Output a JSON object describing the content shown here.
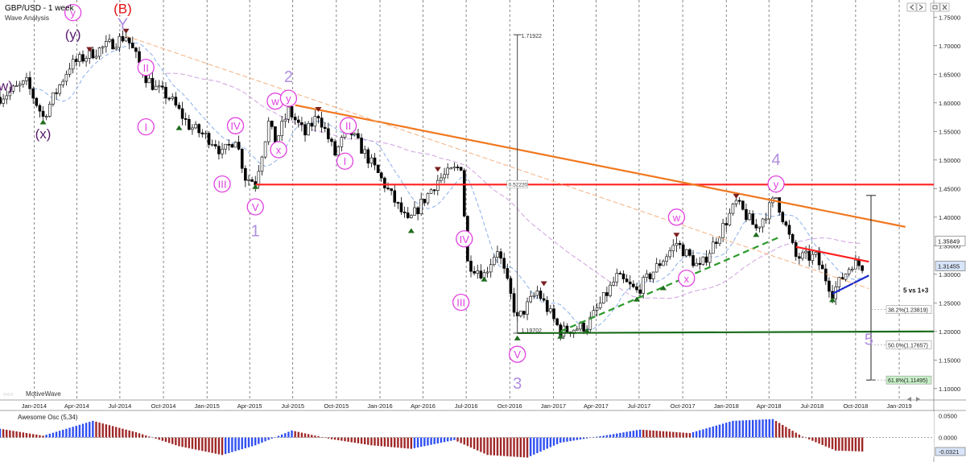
{
  "header": {
    "title": "GBP/USD - 1 week",
    "subtitle": "Wave Analysis",
    "watermark": "MotiveWave"
  },
  "toolbar_icons": [
    "back-icon",
    "forward-icon",
    "restore-icon",
    "close-icon"
  ],
  "colors": {
    "candle_up": "#ffffff",
    "candle_down": "#000000",
    "wave_pink": "#e040e0",
    "wave_purple": "#5a1a6e",
    "wave_lavender": "#b08ee0",
    "wave_red": "#e01010",
    "resistance_red": "#ff2020",
    "trend_orange": "#f07820",
    "support_green": "#1a6b1a",
    "channel_green_dashed": "#2a9a2a",
    "triangle_blue": "#1a2acc",
    "ma_blue": "#8ab0e8",
    "ma_pink": "#d0a0e0",
    "ma_orange": "#f5b080",
    "ao_up": "#3050f0",
    "ao_down": "#a02828"
  },
  "chart_data": {
    "type": "candlestick",
    "title": "GBP/USD - 1 week",
    "subtitle": "Wave Analysis",
    "ylim": [
      1.08,
      1.78
    ],
    "y_ticks": [
      "1.75000",
      "1.70000",
      "1.65000",
      "1.60000",
      "1.55000",
      "1.50000",
      "1.45000",
      "1.40000",
      "1.35000",
      "1.30000",
      "1.25000",
      "1.20000",
      "1.15000",
      "1.10000"
    ],
    "x_ticks": [
      "Jan-2014",
      "Apr-2014",
      "Jul-2014",
      "Oct-2014",
      "Jan-2015",
      "Apr-2015",
      "Jul-2015",
      "Oct-2015",
      "Jan-2016",
      "Apr-2016",
      "Jul-2016",
      "Oct-2016",
      "Jan-2017",
      "Apr-2017",
      "Jul-2017",
      "Oct-2017",
      "Jan-2018",
      "Apr-2018",
      "Jul-2018",
      "Oct-2018",
      "Jan-2019"
    ],
    "x_start": "2013-10-21",
    "x_end": "2019-03-15",
    "grid": true,
    "price_path": [
      [
        "2013-10-21",
        1.61
      ],
      [
        "2013-12-16",
        1.635
      ],
      [
        "2014-01-20",
        1.575
      ],
      [
        "2014-03-17",
        1.665
      ],
      [
        "2014-04-28",
        1.685
      ],
      [
        "2014-06-16",
        1.705
      ],
      [
        "2014-07-14",
        1.717
      ],
      [
        "2014-08-25",
        1.645
      ],
      [
        "2014-09-15",
        1.625
      ],
      [
        "2014-10-13",
        1.61
      ],
      [
        "2014-11-24",
        1.56
      ],
      [
        "2015-01-19",
        1.53
      ],
      [
        "2015-02-02",
        1.51
      ],
      [
        "2015-03-02",
        1.54
      ],
      [
        "2015-03-23",
        1.47
      ],
      [
        "2015-04-13",
        1.462
      ],
      [
        "2015-05-11",
        1.565
      ],
      [
        "2015-05-25",
        1.53
      ],
      [
        "2015-06-22",
        1.587
      ],
      [
        "2015-07-27",
        1.545
      ],
      [
        "2015-08-24",
        1.58
      ],
      [
        "2015-09-28",
        1.51
      ],
      [
        "2015-10-26",
        1.555
      ],
      [
        "2015-12-21",
        1.485
      ],
      [
        "2016-02-29",
        1.39
      ],
      [
        "2016-05-02",
        1.465
      ],
      [
        "2016-06-20",
        1.49
      ],
      [
        "2016-07-04",
        1.32
      ],
      [
        "2016-08-08",
        1.3
      ],
      [
        "2016-09-05",
        1.345
      ],
      [
        "2016-10-17",
        1.22
      ],
      [
        "2016-11-28",
        1.27
      ],
      [
        "2017-01-16",
        1.2
      ],
      [
        "2017-03-13",
        1.21
      ],
      [
        "2017-05-15",
        1.295
      ],
      [
        "2017-06-26",
        1.27
      ],
      [
        "2017-09-18",
        1.355
      ],
      [
        "2017-11-06",
        1.31
      ],
      [
        "2018-01-22",
        1.425
      ],
      [
        "2018-03-05",
        1.38
      ],
      [
        "2018-04-16",
        1.435
      ],
      [
        "2018-05-28",
        1.33
      ],
      [
        "2018-07-09",
        1.33
      ],
      [
        "2018-08-13",
        1.268
      ],
      [
        "2018-09-24",
        1.32
      ],
      [
        "2018-10-15",
        1.3145
      ]
    ],
    "price_labels": [
      {
        "label": "1.35849",
        "value": 1.35849,
        "style": "box"
      },
      {
        "label": "1.31455",
        "value": 1.31455,
        "style": "current"
      }
    ],
    "measure_line": {
      "date": "2016-10-17",
      "from": 1.71922,
      "to": 1.19702,
      "top_label": "1.71922",
      "bottom_label": "1.19702",
      "mid_label": "0.52220",
      "mid_value": 1.457
    },
    "fib_projection": {
      "title": "5 vs 1+3",
      "top": 1.438,
      "bottom": 1.11495,
      "levels": [
        {
          "label": "38.2%(1.23819)",
          "value": 1.23819
        },
        {
          "label": "50.0%(1.17657)",
          "value": 1.17657
        },
        {
          "label": "61.8%(1.11495)",
          "value": 1.11495
        }
      ]
    },
    "lines": [
      {
        "name": "resistance",
        "color": "#ff2020",
        "from": [
          "2015-04-13",
          1.457
        ],
        "to": [
          "2019-03-15",
          1.457
        ],
        "dashed": false
      },
      {
        "name": "downtrend",
        "color": "#f07820",
        "from": [
          "2015-07-06",
          1.596
        ],
        "to": [
          "2019-01-14",
          1.383
        ],
        "dashed": false
      },
      {
        "name": "support",
        "color": "#1a6b1a",
        "from": [
          "2016-10-17",
          1.197
        ],
        "to": [
          "2019-03-15",
          1.2
        ],
        "dashed": false
      },
      {
        "name": "channel",
        "color": "#2a9a2a",
        "from": [
          "2017-01-16",
          1.2
        ],
        "to": [
          "2018-04-23",
          1.365
        ],
        "dashed": true
      },
      {
        "name": "triangle-top",
        "color": "#ff2020",
        "from": [
          "2018-05-28",
          1.348
        ],
        "to": [
          "2018-10-29",
          1.322
        ],
        "dashed": false
      },
      {
        "name": "triangle-bottom",
        "color": "#1a2acc",
        "from": [
          "2018-08-13",
          1.266
        ],
        "to": [
          "2018-10-29",
          1.298
        ],
        "dashed": false
      },
      {
        "name": "ma-orange",
        "color": "#f5b080",
        "from": [
          "2014-07-14",
          1.717
        ],
        "to": [
          "2018-10-29",
          1.275
        ],
        "dashed": true
      }
    ],
    "wave_labels": [
      {
        "text": "y",
        "date": "2014-03-24",
        "price": 1.758,
        "color": "#e040e0",
        "circle": true
      },
      {
        "text": "(B)",
        "date": "2014-07-07",
        "price": 1.765,
        "color": "#e01010",
        "circle": false
      },
      {
        "text": "(y)",
        "date": "2014-03-24",
        "price": 1.72,
        "color": "#5a1a6e",
        "circle": false
      },
      {
        "text": "Y",
        "date": "2014-07-07",
        "price": 1.737,
        "color": "#b08ee0",
        "circle": false
      },
      {
        "text": "(w)",
        "date": "2013-10-28",
        "price": 1.63,
        "color": "#5a1a6e",
        "circle": false
      },
      {
        "text": "(x)",
        "date": "2014-01-20",
        "price": 1.546,
        "color": "#5a1a6e",
        "circle": false
      },
      {
        "text": "II",
        "date": "2014-08-25",
        "price": 1.662,
        "color": "#e040e0",
        "circle": true
      },
      {
        "text": "I",
        "date": "2014-08-25",
        "price": 1.558,
        "color": "#e040e0",
        "circle": true
      },
      {
        "text": "III",
        "date": "2015-02-02",
        "price": 1.458,
        "color": "#e040e0",
        "circle": true
      },
      {
        "text": "IV",
        "date": "2015-03-02",
        "price": 1.56,
        "color": "#e040e0",
        "circle": true
      },
      {
        "text": "V",
        "date": "2015-04-13",
        "price": 1.418,
        "color": "#e040e0",
        "circle": true
      },
      {
        "text": "1",
        "date": "2015-04-13",
        "price": 1.375,
        "color": "#b08ee0",
        "circle": false
      },
      {
        "text": "w",
        "date": "2015-05-25",
        "price": 1.603,
        "color": "#e040e0",
        "circle": true
      },
      {
        "text": "x",
        "date": "2015-06-01",
        "price": 1.518,
        "color": "#e040e0",
        "circle": true
      },
      {
        "text": "y",
        "date": "2015-06-22",
        "price": 1.608,
        "color": "#e040e0",
        "circle": true
      },
      {
        "text": "2",
        "date": "2015-06-22",
        "price": 1.645,
        "color": "#b08ee0",
        "circle": false
      },
      {
        "text": "II",
        "date": "2015-10-26",
        "price": 1.56,
        "color": "#e040e0",
        "circle": true
      },
      {
        "text": "I",
        "date": "2015-10-19",
        "price": 1.498,
        "color": "#e040e0",
        "circle": true
      },
      {
        "text": "IV",
        "date": "2016-06-27",
        "price": 1.362,
        "color": "#e040e0",
        "circle": true
      },
      {
        "text": "III",
        "date": "2016-06-20",
        "price": 1.251,
        "color": "#e040e0",
        "circle": true
      },
      {
        "text": "V",
        "date": "2016-10-17",
        "price": 1.16,
        "color": "#e040e0",
        "circle": true
      },
      {
        "text": "3",
        "date": "2016-10-17",
        "price": 1.108,
        "color": "#b08ee0",
        "circle": false
      },
      {
        "text": "w",
        "date": "2017-09-18",
        "price": 1.4,
        "color": "#e040e0",
        "circle": true
      },
      {
        "text": "x",
        "date": "2017-10-09",
        "price": 1.293,
        "color": "#e040e0",
        "circle": true
      },
      {
        "text": "y",
        "date": "2018-04-16",
        "price": 1.458,
        "color": "#e040e0",
        "circle": true
      },
      {
        "text": "4",
        "date": "2018-04-16",
        "price": 1.5,
        "color": "#b08ee0",
        "circle": false
      },
      {
        "text": "5",
        "date": "2018-10-29",
        "price": 1.185,
        "color": "#b08ee0",
        "circle": false
      }
    ],
    "oscillator": {
      "label": "Awesome Osc (5,34)",
      "ylim": [
        -0.045,
        0.058
      ],
      "y_ticks": [
        "0.0500",
        "0.0000",
        "-0.0321"
      ],
      "current_label": "-0.0321",
      "current_value": -0.0321,
      "path": [
        [
          "2013-10-21",
          0.02
        ],
        [
          "2014-01-20",
          0.004
        ],
        [
          "2014-05-05",
          0.038
        ],
        [
          "2014-08-04",
          0.012
        ],
        [
          "2014-11-03",
          -0.02
        ],
        [
          "2015-02-02",
          -0.04
        ],
        [
          "2015-04-13",
          -0.018
        ],
        [
          "2015-06-29",
          0.016
        ],
        [
          "2015-09-21",
          -0.004
        ],
        [
          "2015-12-14",
          -0.018
        ],
        [
          "2016-03-07",
          -0.026
        ],
        [
          "2016-06-06",
          -0.006
        ],
        [
          "2016-08-15",
          -0.04
        ],
        [
          "2016-11-07",
          -0.046
        ],
        [
          "2017-01-16",
          -0.012
        ],
        [
          "2017-04-17",
          0.004
        ],
        [
          "2017-07-03",
          0.018
        ],
        [
          "2017-10-16",
          0.01
        ],
        [
          "2018-01-15",
          0.038
        ],
        [
          "2018-04-09",
          0.042
        ],
        [
          "2018-06-11",
          0.002
        ],
        [
          "2018-08-20",
          -0.03
        ],
        [
          "2018-10-15",
          -0.0321
        ]
      ]
    }
  }
}
